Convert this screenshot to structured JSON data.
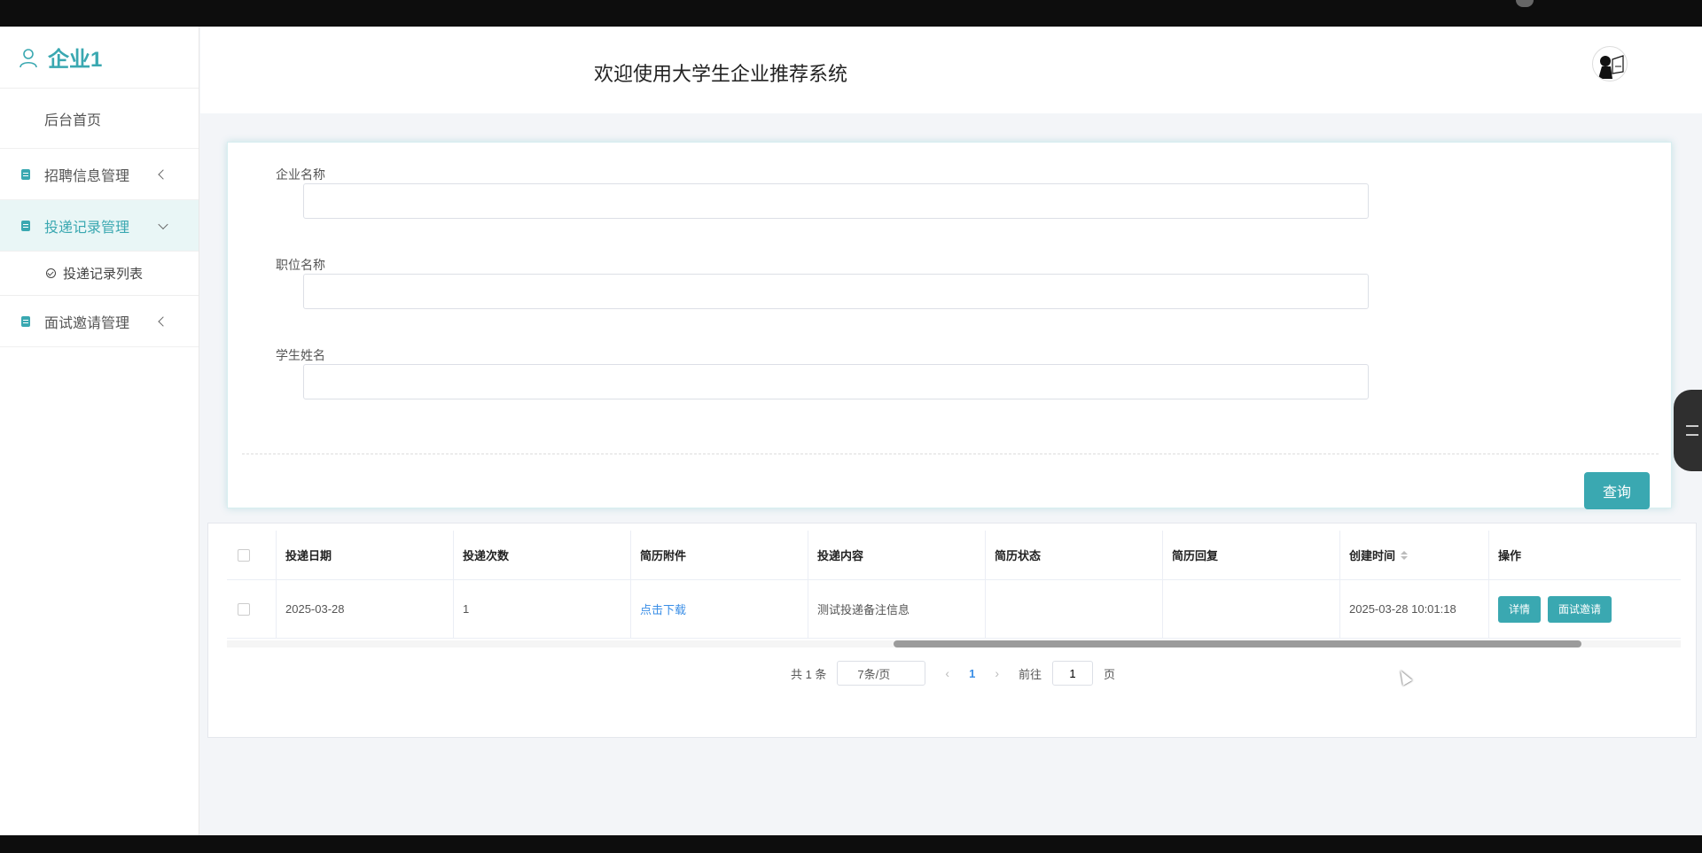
{
  "sidebar": {
    "brand": "企业1",
    "items": [
      {
        "label": "后台首页"
      },
      {
        "label": "招聘信息管理"
      },
      {
        "label": "投递记录管理"
      },
      {
        "label": "投递记录列表"
      },
      {
        "label": "面试邀请管理"
      }
    ]
  },
  "header": {
    "title": "欢迎使用大学生企业推荐系统"
  },
  "search": {
    "company_label": "企业名称",
    "position_label": "职位名称",
    "student_label": "学生姓名",
    "query_button": "查询"
  },
  "table": {
    "headers": [
      "投递日期",
      "投递次数",
      "简历附件",
      "投递内容",
      "简历状态",
      "简历回复",
      "创建时间",
      "操作"
    ],
    "rows": [
      {
        "date": "2025-03-28",
        "count": "1",
        "attachment": "点击下载",
        "content": "测试投递备注信息",
        "status": "",
        "reply": "",
        "created": "2025-03-28 10:01:18",
        "detail_button": "详情",
        "invite_button": "面试邀请"
      }
    ]
  },
  "pager": {
    "total": "共 1 条",
    "page_size": "7条/页",
    "current_page": "1",
    "goto_label": "前往",
    "goto_value": "1",
    "page_suffix": "页"
  },
  "colors": {
    "accent": "#3aa8b1",
    "link": "#3a8ee6"
  }
}
